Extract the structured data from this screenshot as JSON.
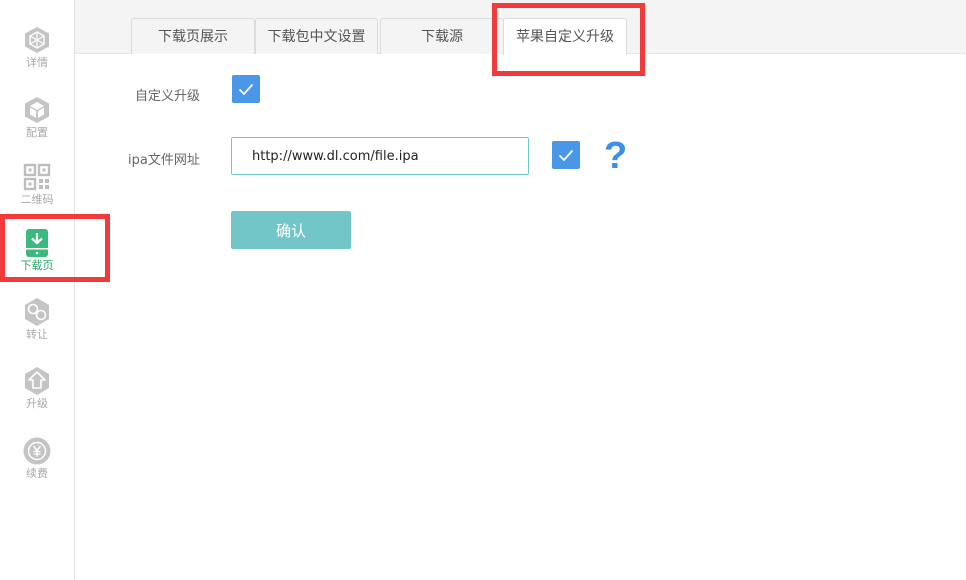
{
  "sidebar": {
    "items": [
      {
        "label": "详情",
        "icon": "cube-outline-icon"
      },
      {
        "label": "配置",
        "icon": "cube-solid-icon"
      },
      {
        "label": "二维码",
        "icon": "qr-code-icon"
      },
      {
        "label": "下载页",
        "icon": "download-page-icon",
        "active": true
      },
      {
        "label": "转让",
        "icon": "transfer-hexagon-icon"
      },
      {
        "label": "升级",
        "icon": "upgrade-arrow-icon"
      },
      {
        "label": "续费",
        "icon": "renew-yen-icon"
      }
    ]
  },
  "tabs": [
    {
      "label": "下载页展示"
    },
    {
      "label": "下载包中文设置"
    },
    {
      "label": "下载源"
    },
    {
      "label": "苹果自定义升级",
      "active": true
    }
  ],
  "form": {
    "custom_upgrade_label": "自定义升级",
    "custom_upgrade_checked": true,
    "ipa_url_label": "ipa文件网址",
    "ipa_url_value": "http://www.dl.com/file.ipa",
    "ipa_url_checked": true,
    "help_symbol": "?",
    "confirm_label": "确认"
  },
  "colors": {
    "accent_blue": "#4a97e8",
    "active_green": "#2aa66a",
    "confirm_teal": "#72c6c7",
    "highlight_red": "#f23a3a"
  }
}
